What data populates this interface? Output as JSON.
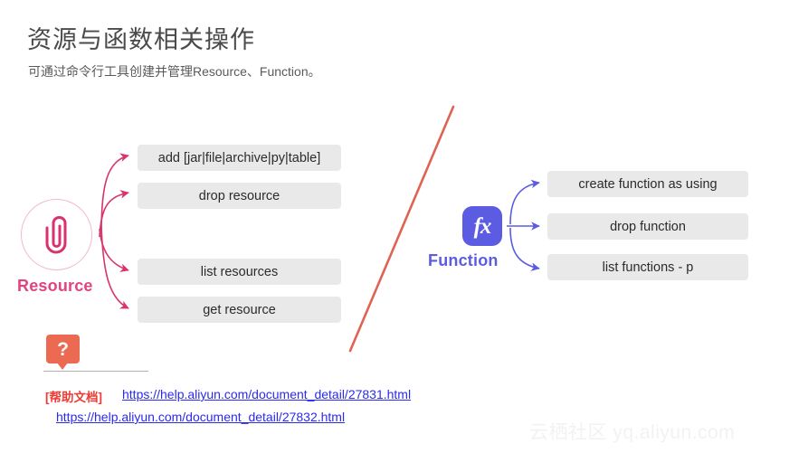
{
  "header": {
    "title": "资源与函数相关操作",
    "subtitle": "可通过命令行工具创建并管理Resource、Function。"
  },
  "resource": {
    "label": "Resource",
    "icon": "paperclip-icon",
    "color": "#e24480",
    "commands": [
      "add [jar|file|archive|py|table]",
      "drop resource",
      "list resources",
      "get resource"
    ]
  },
  "function": {
    "label": "Function",
    "icon": "fx-icon",
    "icon_text": "fx",
    "color": "#5b5ce2",
    "commands": [
      "create function as using",
      "drop function",
      "list functions - p"
    ]
  },
  "help": {
    "badge_icon": "question-mark-icon",
    "badge_text": "?",
    "badge_color": "#ec6a52",
    "tag": "[帮助文档]",
    "links": [
      "https://help.aliyun.com/document_detail/27831.html",
      "https://help.aliyun.com/document_detail/27832.html"
    ]
  },
  "watermark": {
    "text": "云栖社区 yq.aliyun.com"
  }
}
